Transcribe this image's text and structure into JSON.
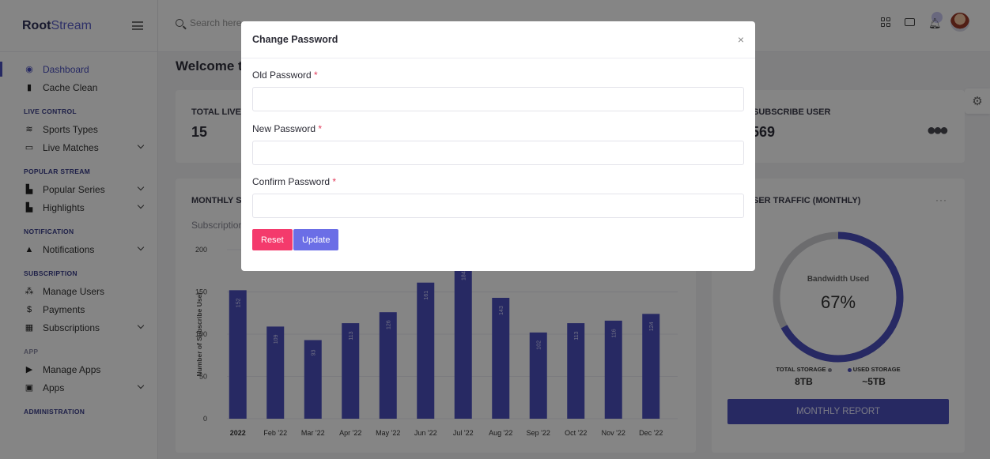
{
  "brand": {
    "bold": "Root",
    "light": "Stream"
  },
  "search": {
    "placeholder": "Search here"
  },
  "sidebar": {
    "top": [
      {
        "label": "Dashboard",
        "icon": "dashboard-icon",
        "glyph": "◉",
        "active": true
      },
      {
        "label": "Cache Clean",
        "icon": "trash-icon",
        "glyph": "▮"
      }
    ],
    "sections": [
      {
        "title": "LIVE CONTROL",
        "items": [
          {
            "label": "Sports Types",
            "icon": "layers-icon",
            "glyph": "≋"
          },
          {
            "label": "Live Matches",
            "icon": "monitor-icon",
            "glyph": "▭",
            "chevron": true
          }
        ]
      },
      {
        "title": "POPULAR STREAM",
        "items": [
          {
            "label": "Popular Series",
            "icon": "file-icon",
            "glyph": "▙",
            "chevron": true
          },
          {
            "label": "Highlights",
            "icon": "file-icon",
            "glyph": "▙",
            "chevron": true
          }
        ]
      },
      {
        "title": "NOTIFICATION",
        "items": [
          {
            "label": "Notifications",
            "icon": "bell-icon",
            "glyph": "▲",
            "chevron": true
          }
        ]
      },
      {
        "title": "SUBSCRIPTION",
        "items": [
          {
            "label": "Manage Users",
            "icon": "users-icon",
            "glyph": "⁂"
          },
          {
            "label": "Payments",
            "icon": "dollar-icon",
            "glyph": "$"
          },
          {
            "label": "Subscriptions",
            "icon": "grid-icon",
            "glyph": "▦",
            "chevron": true
          }
        ]
      },
      {
        "title": "APP",
        "dim": true,
        "items": [
          {
            "label": "Manage Apps",
            "icon": "play-icon",
            "glyph": "▶"
          },
          {
            "label": "Apps",
            "icon": "image-icon",
            "glyph": "▣",
            "chevron": true
          }
        ]
      },
      {
        "title": "ADMINISTRATION",
        "items": []
      }
    ]
  },
  "main": {
    "welcome": "Welcome to",
    "stat_live": {
      "label": "TOTAL LIVE",
      "value": "15"
    },
    "stat_subscribe": {
      "label": "SUBSCRIBE USER",
      "value": "569"
    },
    "monthly_title": "MONTHLY SU",
    "monthly_subtitle": "Subscription",
    "traffic": {
      "title": "SER TRAFFIC (MONTHLY)",
      "menu": "···"
    }
  },
  "chart_data": {
    "type": "bar",
    "ylabel": "Number of Subscribe User",
    "ylim": [
      0,
      200
    ],
    "yticks": [
      0,
      50,
      100,
      150,
      200
    ],
    "categories": [
      "2022",
      "Feb '22",
      "Mar '22",
      "Apr '22",
      "May '22",
      "Jun '22",
      "Jul '22",
      "Aug '22",
      "Sep '22",
      "Oct '22",
      "Nov '22",
      "Dec '22"
    ],
    "values": [
      152,
      109,
      93,
      113,
      126,
      161,
      184,
      143,
      102,
      113,
      116,
      124
    ],
    "bar_color": "#4b4fbf"
  },
  "donut": {
    "label": "Bandwidth Used",
    "percent_text": "67%",
    "percent": 67,
    "track_color": "#cfcfd4",
    "fill_color": "#4b4fbf",
    "legend": [
      {
        "name": "TOTAL STORAGE",
        "value": "8TB",
        "color": "#8a8a96"
      },
      {
        "name": "USED STORAGE",
        "value": "~5TB",
        "color": "#4b4fbf"
      }
    ],
    "button": "MONTHLY REPORT"
  },
  "modal": {
    "title": "Change Password",
    "close": "×",
    "fields": [
      {
        "label": "Old Password",
        "required": "*"
      },
      {
        "label": "New Password",
        "required": "*"
      },
      {
        "label": "Confirm Password",
        "required": "*"
      }
    ],
    "reset": "Reset",
    "update": "Update"
  }
}
